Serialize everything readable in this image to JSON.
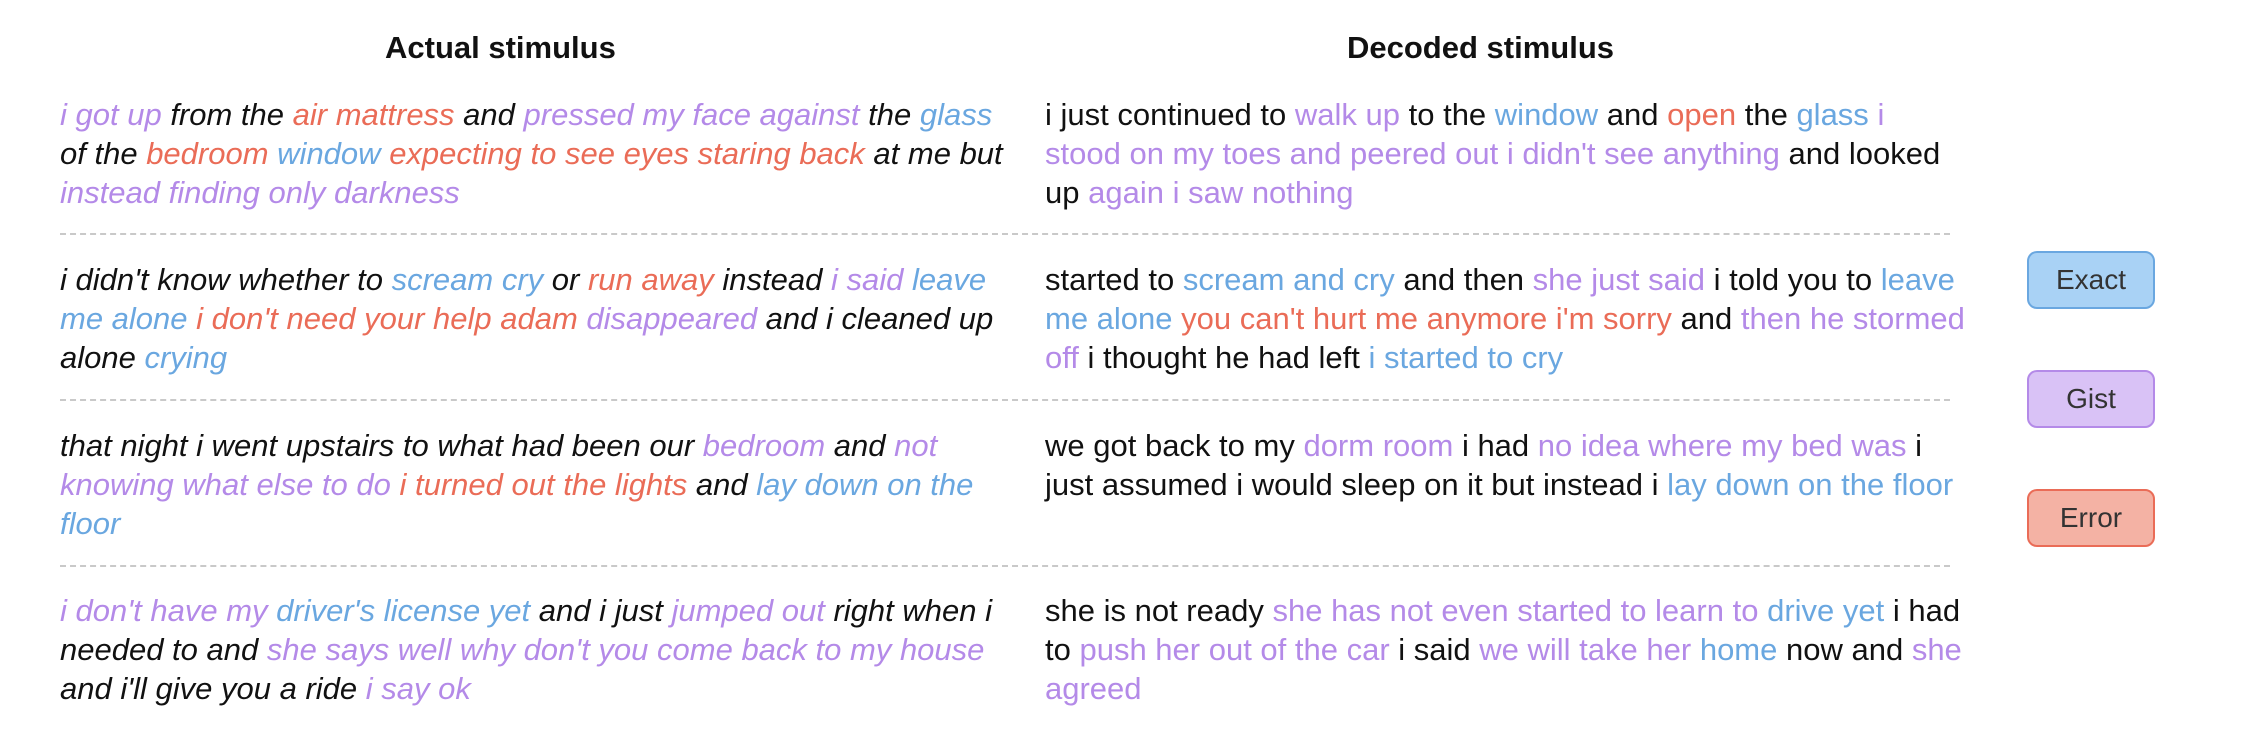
{
  "headers": {
    "actual": "Actual stimulus",
    "decoded": "Decoded stimulus"
  },
  "legend": {
    "exact": "Exact",
    "gist": "Gist",
    "error": "Error"
  },
  "colors": {
    "exact": "#6aa7e0",
    "gist": "#b48ae8",
    "error": "#ea6c57",
    "neutral": "#111111"
  },
  "rows": [
    {
      "actual": [
        {
          "t": "i got up",
          "c": "g"
        },
        {
          "t": " from the ",
          "c": "n"
        },
        {
          "t": "air mattress",
          "c": "r"
        },
        {
          "t": " and ",
          "c": "n"
        },
        {
          "t": "pressed my face against",
          "c": "g"
        },
        {
          "t": " the ",
          "c": "n"
        },
        {
          "t": "glass",
          "c": "e"
        },
        {
          "t": " of the ",
          "c": "n"
        },
        {
          "t": "bedroom",
          "c": "r"
        },
        {
          "t": " ",
          "c": "n"
        },
        {
          "t": "window",
          "c": "e"
        },
        {
          "t": " ",
          "c": "n"
        },
        {
          "t": "expecting to see eyes staring back",
          "c": "r"
        },
        {
          "t": " at me but ",
          "c": "n"
        },
        {
          "t": "instead finding only darkness",
          "c": "g"
        }
      ],
      "decoded": [
        {
          "t": "i just continued to ",
          "c": "n"
        },
        {
          "t": "walk up",
          "c": "g"
        },
        {
          "t": " to the ",
          "c": "n"
        },
        {
          "t": "window",
          "c": "e"
        },
        {
          "t": " and ",
          "c": "n"
        },
        {
          "t": "open",
          "c": "r"
        },
        {
          "t": " the ",
          "c": "n"
        },
        {
          "t": "glass",
          "c": "e"
        },
        {
          "t": " ",
          "c": "n"
        },
        {
          "t": "i stood on my toes and peered out i didn't see anything",
          "c": "g"
        },
        {
          "t": " and looked up ",
          "c": "n"
        },
        {
          "t": "again i saw nothing",
          "c": "g"
        }
      ]
    },
    {
      "actual": [
        {
          "t": "i didn't know whether to ",
          "c": "n"
        },
        {
          "t": "scream cry",
          "c": "e"
        },
        {
          "t": " or ",
          "c": "n"
        },
        {
          "t": "run away",
          "c": "r"
        },
        {
          "t": " instead ",
          "c": "n"
        },
        {
          "t": "i said",
          "c": "g"
        },
        {
          "t": " ",
          "c": "n"
        },
        {
          "t": "leave me alone",
          "c": "e"
        },
        {
          "t": " ",
          "c": "n"
        },
        {
          "t": "i don't need your help adam",
          "c": "r"
        },
        {
          "t": " ",
          "c": "n"
        },
        {
          "t": "disappeared",
          "c": "g"
        },
        {
          "t": " and i cleaned up alone ",
          "c": "n"
        },
        {
          "t": "crying",
          "c": "e"
        }
      ],
      "decoded": [
        {
          "t": "started to ",
          "c": "n"
        },
        {
          "t": "scream and cry",
          "c": "e"
        },
        {
          "t": " and then ",
          "c": "n"
        },
        {
          "t": "she just said",
          "c": "g"
        },
        {
          "t": " i told you to ",
          "c": "n"
        },
        {
          "t": "leave me alone",
          "c": "e"
        },
        {
          "t": " ",
          "c": "n"
        },
        {
          "t": "you can't hurt me anymore i'm sorry",
          "c": "r"
        },
        {
          "t": " and ",
          "c": "n"
        },
        {
          "t": "then he stormed off",
          "c": "g"
        },
        {
          "t": " i thought he had left ",
          "c": "n"
        },
        {
          "t": "i started to cry",
          "c": "e"
        }
      ]
    },
    {
      "actual": [
        {
          "t": "that night i went upstairs to what had been our ",
          "c": "n"
        },
        {
          "t": "bedroom",
          "c": "g"
        },
        {
          "t": " and ",
          "c": "n"
        },
        {
          "t": "not knowing what else to do",
          "c": "g"
        },
        {
          "t": " ",
          "c": "n"
        },
        {
          "t": "i turned out the lights",
          "c": "r"
        },
        {
          "t": " and ",
          "c": "n"
        },
        {
          "t": "lay down on the floor",
          "c": "e"
        }
      ],
      "decoded": [
        {
          "t": "we got back to my ",
          "c": "n"
        },
        {
          "t": "dorm room",
          "c": "g"
        },
        {
          "t": " i had ",
          "c": "n"
        },
        {
          "t": "no idea where my bed was",
          "c": "g"
        },
        {
          "t": " i just assumed i would sleep on it but instead i ",
          "c": "n"
        },
        {
          "t": "lay down on the floor",
          "c": "e"
        }
      ]
    },
    {
      "actual": [
        {
          "t": "i don't have my ",
          "c": "g"
        },
        {
          "t": "driver's license yet",
          "c": "e"
        },
        {
          "t": " and i just ",
          "c": "n"
        },
        {
          "t": "jumped out",
          "c": "g"
        },
        {
          "t": " right when i needed to and ",
          "c": "n"
        },
        {
          "t": "she says well why don't you come back to my house",
          "c": "g"
        },
        {
          "t": " and i'll give you a ride ",
          "c": "n"
        },
        {
          "t": "i say ok",
          "c": "g"
        }
      ],
      "decoded": [
        {
          "t": "she is not ready ",
          "c": "n"
        },
        {
          "t": "she has not even started to learn to",
          "c": "g"
        },
        {
          "t": " ",
          "c": "n"
        },
        {
          "t": "drive yet",
          "c": "e"
        },
        {
          "t": " i had to ",
          "c": "n"
        },
        {
          "t": "push her out of the car",
          "c": "g"
        },
        {
          "t": " i said ",
          "c": "n"
        },
        {
          "t": "we will take her",
          "c": "g"
        },
        {
          "t": " ",
          "c": "n"
        },
        {
          "t": "home",
          "c": "e"
        },
        {
          "t": " now and ",
          "c": "n"
        },
        {
          "t": "she agreed",
          "c": "g"
        }
      ]
    }
  ]
}
